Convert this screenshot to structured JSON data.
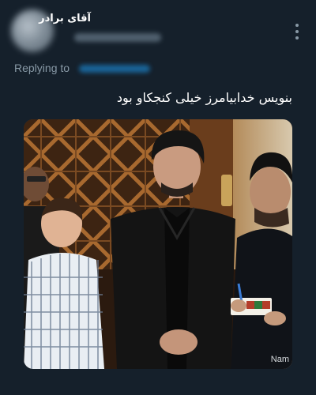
{
  "tweet": {
    "display_name": "آقای برادر",
    "replying_label": "Replying to",
    "text": "بنویس خدابیامرز خیلی کنجکاو بود",
    "media": {
      "watermark": "Nam"
    }
  },
  "icons": {
    "more": "more-vertical-icon",
    "avatar": "avatar-blurred"
  }
}
